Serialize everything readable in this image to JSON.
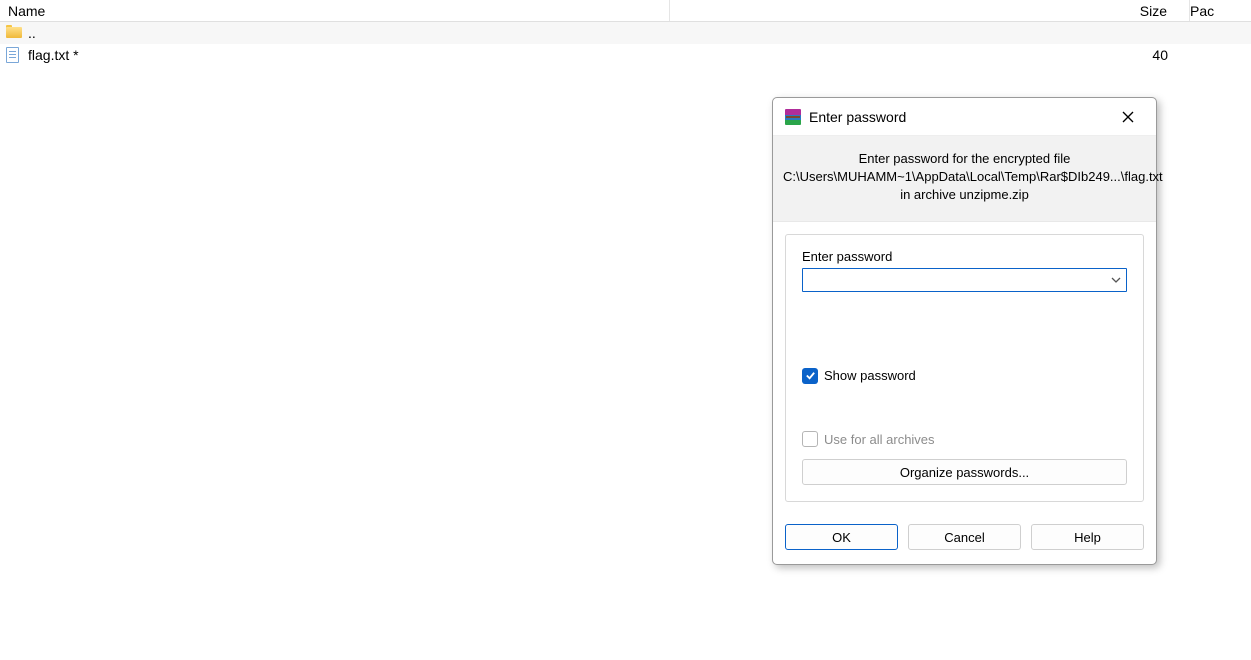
{
  "columns": {
    "name": "Name",
    "size": "Size",
    "packed": "Pac"
  },
  "rows": [
    {
      "type": "up",
      "name": "..",
      "size": ""
    },
    {
      "type": "file",
      "name": "flag.txt *",
      "size": "40"
    }
  ],
  "dialog": {
    "title": "Enter password",
    "message_line1": "Enter password for the encrypted file",
    "message_line2": "C:\\Users\\MUHAMM~1\\AppData\\Local\\Temp\\Rar$DIb249...\\flag.txt",
    "message_line3": "in archive unzipme.zip",
    "field_label": "Enter password",
    "password_value": "",
    "show_password_label": "Show password",
    "show_password_checked": true,
    "use_for_all_label": "Use for all archives",
    "use_for_all_checked": false,
    "organize_label": "Organize passwords...",
    "buttons": {
      "ok": "OK",
      "cancel": "Cancel",
      "help": "Help"
    }
  }
}
